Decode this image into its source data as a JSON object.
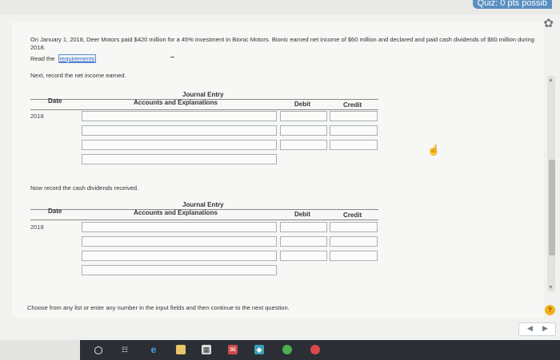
{
  "header": {
    "score_text": "Quiz: 0 pts possib"
  },
  "question": {
    "text": "On January 1, 2018, Deer Motors paid $420 million for a 45% investment in Bionic Motors. Bionic earned net income of $60 million and declared and paid cash dividends of $60 million during 2018.",
    "read_prefix": "Read the",
    "requirements_link": "requirements"
  },
  "part1": {
    "prompt": "Next, record the net income earned.",
    "title": "Journal Entry",
    "subtitle": "Accounts and Explanations",
    "col_date": "Date",
    "col_debit": "Debit",
    "col_credit": "Credit",
    "year": "2018"
  },
  "part2": {
    "prompt": "Now record the cash dividends received.",
    "title": "Journal Entry",
    "subtitle": "Accounts and Explanations",
    "col_date": "Date",
    "col_debit": "Debit",
    "col_credit": "Credit",
    "year": "2018"
  },
  "footer": {
    "instruction": "Choose from any list or enter any number in the input fields and then continue to the next question.",
    "help_label": "?",
    "prev_label": "◀",
    "next_label": "▶"
  },
  "taskbar": {
    "icons": [
      "search-icon",
      "task-view-icon",
      "edge-icon",
      "file-explorer-icon",
      "store-icon",
      "mail-icon",
      "maps-icon",
      "chrome-icon"
    ]
  },
  "colors": {
    "accent": "#2f62c8",
    "help": "#f2b31a"
  }
}
